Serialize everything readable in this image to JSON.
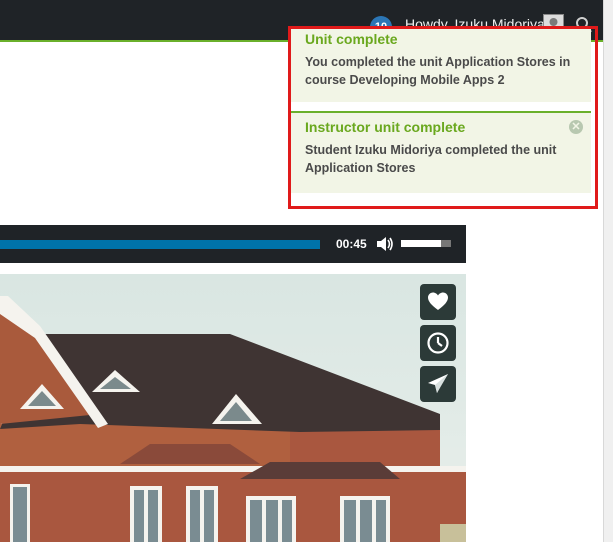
{
  "adminbar": {
    "notification_count": "10",
    "greeting": "Howdy, Izuku Midoriya",
    "avatar_icon": "avatar-icon",
    "search_icon": "search-icon"
  },
  "notifications": [
    {
      "title": "Unit complete",
      "body": "You completed the unit Application Stores in course Developing Mobile Apps 2"
    },
    {
      "title": "Instructor unit complete",
      "body": "Student Izuku Midoriya completed the unit Application Stores",
      "close_icon": "close-circle-icon"
    }
  ],
  "player": {
    "time": "00:45",
    "progress": 1.0,
    "volume": 0.8,
    "volume_icon": "volume-icon"
  },
  "side_buttons": {
    "like_icon": "heart-icon",
    "later_icon": "clock-icon",
    "share_icon": "paper-plane-icon"
  },
  "colors": {
    "accent_green": "#6ab02b",
    "highlight_red": "#e01a1a",
    "player_blue": "#0073aa"
  }
}
